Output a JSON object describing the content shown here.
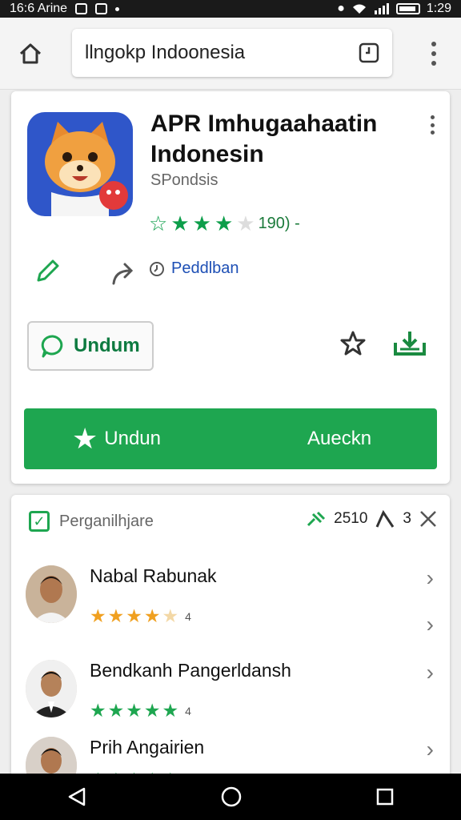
{
  "status_bar": {
    "time_left": "16:6 Arine",
    "time_right": "1:29"
  },
  "browser": {
    "url_text": "llngokp Indoonesia"
  },
  "app": {
    "title": "APR Imhugaahaatin Indonesin",
    "developer": "SPondsis",
    "rating_text": "190) -",
    "stars_filled": 3,
    "secondary_link": "Peddlban",
    "outline_button": "Undum",
    "primary_left": "Undun",
    "primary_right": "Aueckn",
    "accent_color": "#1ea650"
  },
  "reviews": {
    "header_title": "Perganilhjare",
    "header_count": "2510",
    "header_misc": "3",
    "items": [
      {
        "name": "Nabal Rabunak",
        "stars": 4,
        "star_color": "#f0a020",
        "meta": "4"
      },
      {
        "name": "Bendkanh Pangerldansh",
        "stars": 5,
        "star_color": "#1ea650",
        "meta": "4"
      },
      {
        "name": "Prih Angairien",
        "stars": 5,
        "star_color": "#1ea650",
        "meta": ""
      }
    ]
  }
}
